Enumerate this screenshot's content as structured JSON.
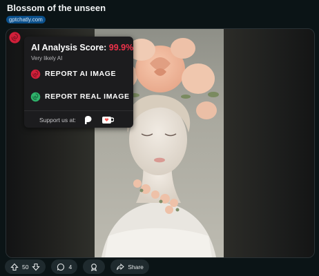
{
  "post": {
    "title": "Blossom of the unseen",
    "domain": "gptchatly.com"
  },
  "ai_popup": {
    "score_label": "AI Analysis Score:",
    "score_value": "99.9%",
    "verdict": "Very likely AI",
    "report_ai_label": "REPORT AI IMAGE",
    "report_real_label": "REPORT REAL IMAGE",
    "support_label": "Support us at:",
    "accent": "#f0324a",
    "real_accent": "#2fb36b"
  },
  "actions": {
    "vote_count": "50",
    "comment_count": "4",
    "share_label": "Share"
  }
}
